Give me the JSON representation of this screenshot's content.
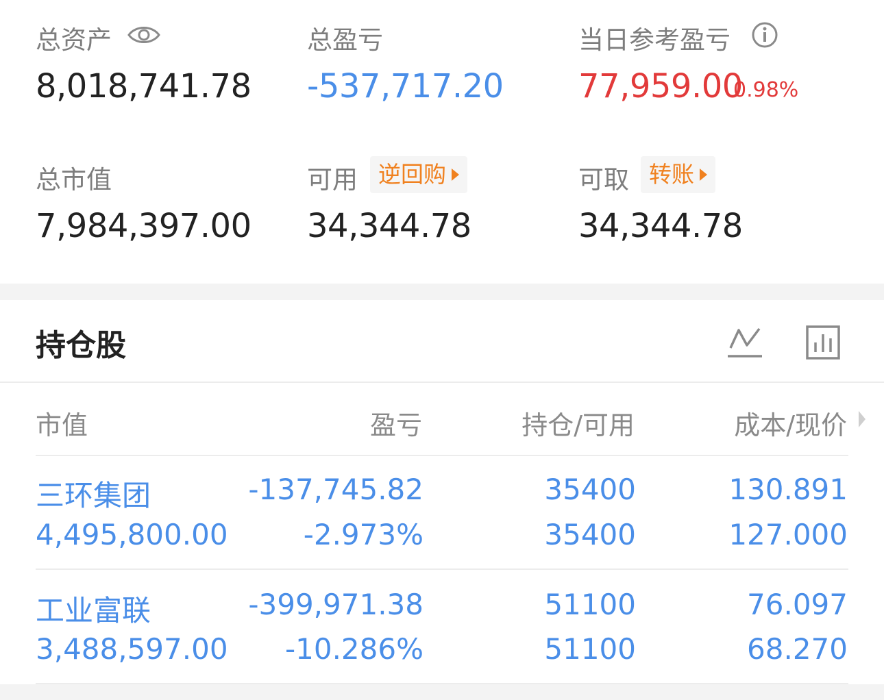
{
  "summary": {
    "total_assets": {
      "label": "总资产",
      "value": "8,018,741.78"
    },
    "total_pnl": {
      "label": "总盈亏",
      "value": "-537,717.20"
    },
    "daily_pnl": {
      "label": "当日参考盈亏",
      "value": "77,959.00",
      "percent": "0.98%"
    },
    "market_value": {
      "label": "总市值",
      "value": "7,984,397.00"
    },
    "available": {
      "label": "可用",
      "tag": "逆回购",
      "value": "34,344.78"
    },
    "withdrawable": {
      "label": "可取",
      "tag": "转账",
      "value": "34,344.78"
    }
  },
  "holdings": {
    "title": "持仓股",
    "columns": [
      "市值",
      "盈亏",
      "持仓/可用",
      "成本/现价"
    ],
    "rows": [
      {
        "name": "三环集团",
        "market_value": "4,495,800.00",
        "pnl": "-137,745.82",
        "pnl_pct": "-2.973%",
        "position": "35400",
        "available": "35400",
        "cost": "130.891",
        "price": "127.000"
      },
      {
        "name": "工业富联",
        "market_value": "3,488,597.00",
        "pnl": "-399,971.38",
        "pnl_pct": "-10.286%",
        "position": "51100",
        "available": "51100",
        "cost": "76.097",
        "price": "68.270"
      }
    ]
  },
  "colors": {
    "positive": "#e23a3a",
    "negative": "#4a8ee8",
    "tag": "#f0811f"
  },
  "icons": [
    "eye-icon",
    "info-icon",
    "line-chart-icon",
    "bar-chart-icon",
    "chevron-right-icon"
  ]
}
